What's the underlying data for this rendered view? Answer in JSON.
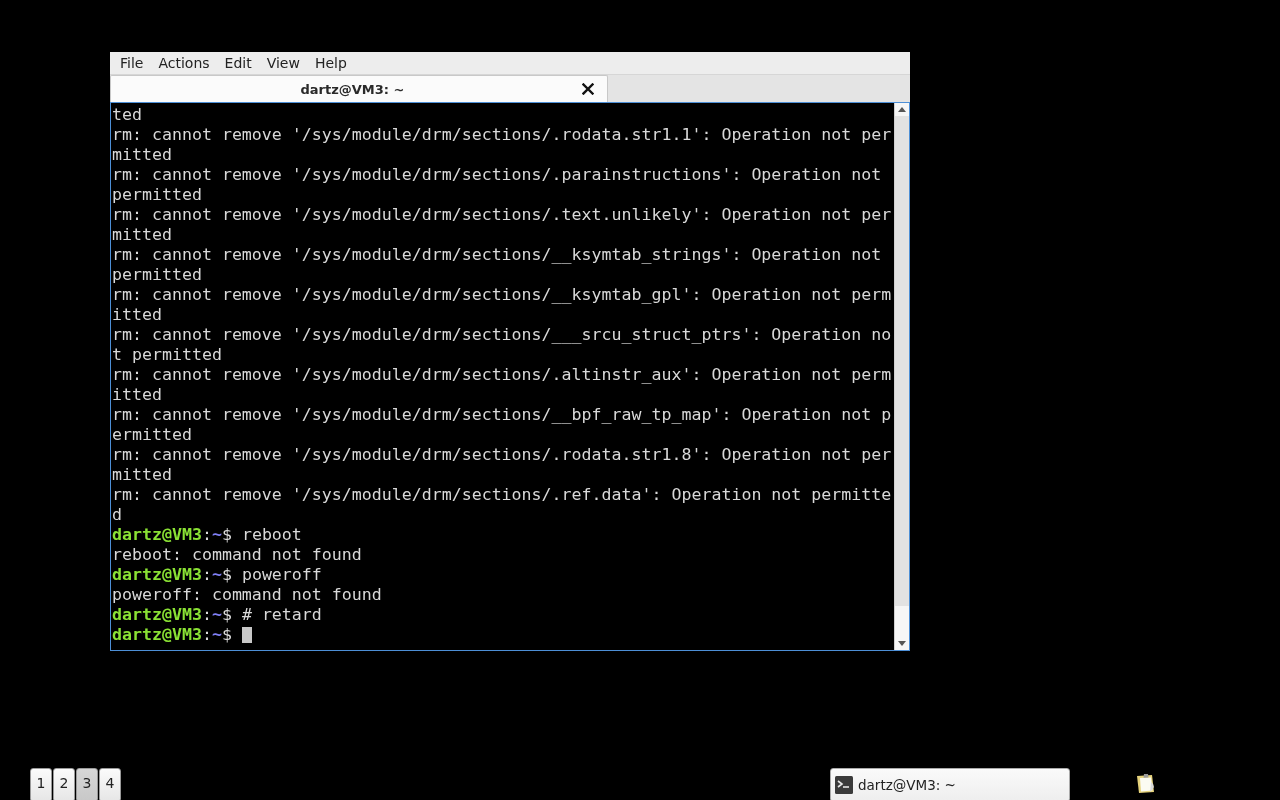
{
  "menu_bar": [
    "File",
    "Actions",
    "Edit",
    "View",
    "Help"
  ],
  "tabs": [
    {
      "label": "dartz@VM3: ~",
      "selected": true
    }
  ],
  "terminal": {
    "lines": [
      {
        "kind": "output",
        "text": "ted"
      },
      {
        "kind": "output",
        "text": "rm: cannot remove '/sys/module/drm/sections/.rodata.str1.1': Operation not per"
      },
      {
        "kind": "output",
        "text": "mitted"
      },
      {
        "kind": "output",
        "text": "rm: cannot remove '/sys/module/drm/sections/.parainstructions': Operation not"
      },
      {
        "kind": "output",
        "text": "permitted"
      },
      {
        "kind": "output",
        "text": "rm: cannot remove '/sys/module/drm/sections/.text.unlikely': Operation not per"
      },
      {
        "kind": "output",
        "text": "mitted"
      },
      {
        "kind": "output",
        "text": "rm: cannot remove '/sys/module/drm/sections/__ksymtab_strings': Operation not"
      },
      {
        "kind": "output",
        "text": "permitted"
      },
      {
        "kind": "output",
        "text": "rm: cannot remove '/sys/module/drm/sections/__ksymtab_gpl': Operation not perm"
      },
      {
        "kind": "output",
        "text": "itted"
      },
      {
        "kind": "output",
        "text": "rm: cannot remove '/sys/module/drm/sections/___srcu_struct_ptrs': Operation no"
      },
      {
        "kind": "output",
        "text": "t permitted"
      },
      {
        "kind": "output",
        "text": "rm: cannot remove '/sys/module/drm/sections/.altinstr_aux': Operation not perm"
      },
      {
        "kind": "output",
        "text": "itted"
      },
      {
        "kind": "output",
        "text": "rm: cannot remove '/sys/module/drm/sections/__bpf_raw_tp_map': Operation not p"
      },
      {
        "kind": "output",
        "text": "ermitted"
      },
      {
        "kind": "output",
        "text": "rm: cannot remove '/sys/module/drm/sections/.rodata.str1.8': Operation not per"
      },
      {
        "kind": "output",
        "text": "mitted"
      },
      {
        "kind": "output",
        "text": "rm: cannot remove '/sys/module/drm/sections/.ref.data': Operation not permitte"
      },
      {
        "kind": "output",
        "text": "d"
      },
      {
        "kind": "prompt",
        "user_host": "dartz@VM3",
        "separator": ":",
        "path": "~",
        "input": "$ reboot"
      },
      {
        "kind": "output",
        "text": "reboot: command not found"
      },
      {
        "kind": "prompt",
        "user_host": "dartz@VM3",
        "separator": ":",
        "path": "~",
        "input": "$ poweroff"
      },
      {
        "kind": "output",
        "text": "poweroff: command not found"
      },
      {
        "kind": "prompt",
        "user_host": "dartz@VM3",
        "separator": ":",
        "path": "~",
        "input": "$ # retard"
      },
      {
        "kind": "prompt",
        "user_host": "dartz@VM3",
        "separator": ":",
        "path": "~",
        "input": "$"
      }
    ],
    "cursor_visible": true
  },
  "taskbar": {
    "workspaces": [
      {
        "label": "1",
        "selected": false
      },
      {
        "label": "2",
        "selected": false
      },
      {
        "label": "3",
        "selected": true
      },
      {
        "label": "4",
        "selected": false
      }
    ],
    "windows": [
      {
        "label": "dartz@VM3: ~",
        "selected": false
      }
    ]
  }
}
